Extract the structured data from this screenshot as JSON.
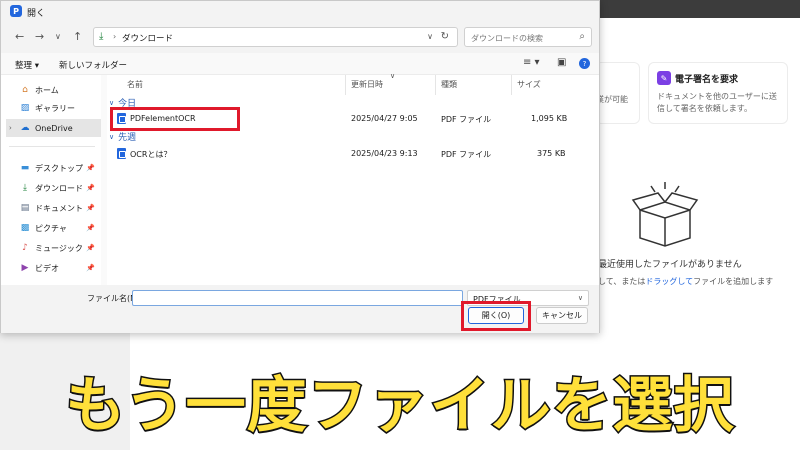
{
  "background_app": {
    "card_partial_text": "業が可能",
    "card_title": "電子署名を要求",
    "card_desc": "ドキュメントを他のユーザーに送信して署名を依頼します。",
    "empty_title": "最近使用したファイルがありません",
    "empty_desc_prefix": "して、または",
    "empty_desc_link": "ドラッグして",
    "empty_desc_suffix": "ファイルを追加します"
  },
  "dialog": {
    "title": "開く",
    "app_icon_letter": "P",
    "breadcrumb": "ダウンロード",
    "search_placeholder": "ダウンロードの検索",
    "toolbar": {
      "organize": "整理 ▾",
      "new_folder": "新しいフォルダー"
    },
    "sidebar": [
      {
        "label": "ホーム",
        "icon": "home-icon"
      },
      {
        "label": "ギャラリー",
        "icon": "gallery-icon"
      },
      {
        "label": "OneDrive",
        "icon": "cloud-icon"
      },
      {
        "label": "デスクトップ",
        "icon": "desktop-icon"
      },
      {
        "label": "ダウンロード",
        "icon": "download-icon"
      },
      {
        "label": "ドキュメント",
        "icon": "document-icon"
      },
      {
        "label": "ピクチャ",
        "icon": "picture-icon"
      },
      {
        "label": "ミュージック",
        "icon": "music-icon"
      },
      {
        "label": "ビデオ",
        "icon": "video-icon"
      }
    ],
    "columns": {
      "name": "名前",
      "modified": "更新日時",
      "type": "種類",
      "size": "サイズ"
    },
    "groups": [
      {
        "label": "今日",
        "files": [
          {
            "name": "PDFelementOCR",
            "modified": "2025/04/27 9:05",
            "type": "PDF ファイル",
            "size": "1,095 KB"
          }
        ]
      },
      {
        "label": "先週",
        "files": [
          {
            "name": "OCRとは？",
            "modified": "2025/04/23 9:13",
            "type": "PDF ファイル",
            "size": "375 KB"
          }
        ]
      }
    ],
    "filename_label": "ファイル名(N):",
    "filename_value": "",
    "filetype": "PDFファイル",
    "open_button": "開く(O)",
    "cancel_button": "キャンセル"
  },
  "caption": "もう一度ファイルを選択",
  "colors": {
    "highlight_red": "#e0192b",
    "caption_yellow": "#ffe03a",
    "accent_blue": "#2266dd"
  }
}
